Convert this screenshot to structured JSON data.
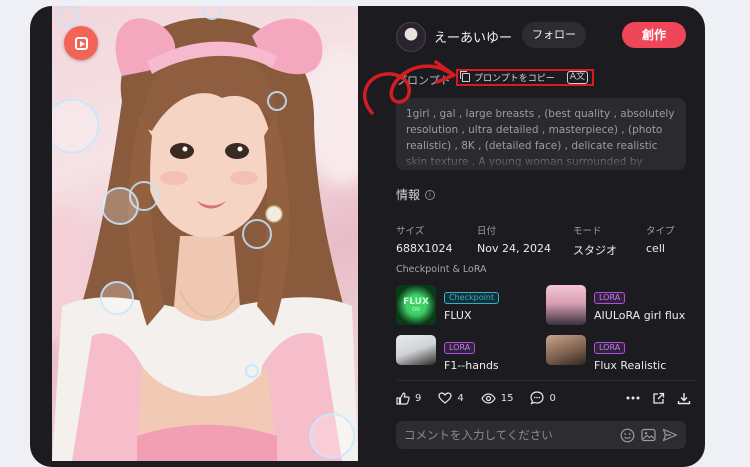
{
  "post": {
    "username": "えーあいゆー",
    "follow_label": "フォロー",
    "create_label": "創作",
    "prompt_label": "プロンプト",
    "copy_prompt_label": "プロンプトをコピー",
    "prompt_text": "1girl , gal , large breasts , (best quality , absolutely resolution , ultra detailed , masterpiece) , (photo realistic) , 8K , (detailed face) , delicate realistic skin texture , A young woman surrounded by beautiful ,"
  },
  "info": {
    "title": "情報",
    "fields": [
      {
        "key": "サイズ",
        "value": "688X1024"
      },
      {
        "key": "日付",
        "value": "Nov 24, 2024"
      },
      {
        "key": "モード",
        "value": "スタジオ"
      },
      {
        "key": "タイプ",
        "value": "cell"
      }
    ]
  },
  "models": {
    "title": "Checkpoint & LoRA",
    "items": [
      {
        "tag": "Checkpoint",
        "name": "FLUX",
        "thumb_text": "FLUX ON"
      },
      {
        "tag": "LORA",
        "name": "AIULoRA girl flux"
      },
      {
        "tag": "LORA",
        "name": "F1--hands"
      },
      {
        "tag": "LORA",
        "name": "Flux Realistic"
      }
    ]
  },
  "stats": {
    "likes": "9",
    "favorites": "4",
    "views": "15",
    "comments": "0"
  },
  "comment": {
    "placeholder": "コメントを入力してください"
  },
  "icons": {
    "photo_badge": "video-icon",
    "copy": "copy-icon",
    "translate": "translate-icon",
    "info": "info-icon",
    "like": "thumbs-up-icon",
    "favorite": "heart-icon",
    "views": "eye-icon",
    "comments": "comment-icon",
    "more": "more-icon",
    "share": "share-icon",
    "download": "download-icon",
    "emoji": "emoji-icon",
    "image": "image-icon",
    "send": "send-icon"
  },
  "colors": {
    "panel_bg": "#1c1c20",
    "accent": "#f0465a",
    "annotation": "#d31d22",
    "checkpoint_tag": "#23b6c8",
    "lora_tag": "#b04fe0"
  }
}
